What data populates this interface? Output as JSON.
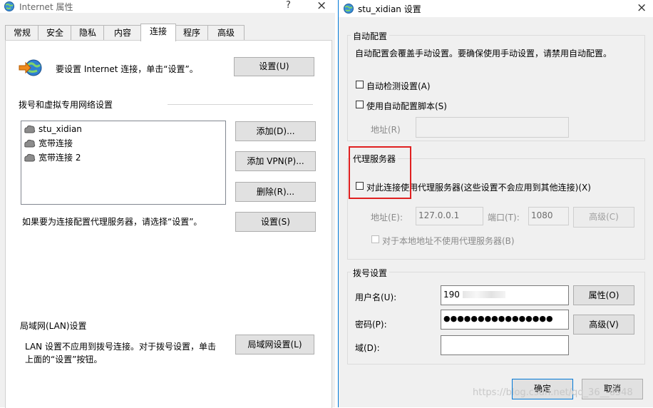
{
  "left_window": {
    "title": "Internet 属性",
    "help_glyph": "?",
    "close_glyph": "×",
    "tabs": [
      "常规",
      "安全",
      "隐私",
      "内容",
      "连接",
      "程序",
      "高级"
    ],
    "active_tab": "连接",
    "setup_text": "要设置 Internet 连接，单击“设置”。",
    "setup_button": "设置(U)",
    "dialup_section": "拨号和虚拟专用网络设置",
    "connections": [
      "stu_xidian",
      "宽带连接",
      "宽带连接 2"
    ],
    "add_button": "添加(D)...",
    "add_vpn_button": "添加 VPN(P)...",
    "delete_button": "删除(R)...",
    "proxy_hint": "如果要为连接配置代理服务器，请选择“设置”。",
    "settings_button": "设置(S)",
    "lan_section": "局域网(LAN)设置",
    "lan_text_line1": "LAN 设置不应用到拨号连接。对于拨号设置，单击",
    "lan_text_line2": "上面的“设置”按钮。",
    "lan_button": "局域网设置(L)"
  },
  "right_window": {
    "title": "stu_xidian 设置",
    "close_glyph": "×",
    "auto_config": {
      "group_title": "自动配置",
      "description": "自动配置会覆盖手动设置。要确保使用手动设置，请禁用自动配置。",
      "auto_detect_label": "自动检测设置(A)",
      "auto_detect_checked": false,
      "use_script_label": "使用自动配置脚本(S)",
      "use_script_checked": false,
      "address_label": "地址(R)",
      "address_value": ""
    },
    "proxy": {
      "group_title": "代理服务器",
      "use_proxy_label": "对此连接使用代理服务器(这些设置不会应用到其他连接)(X)",
      "use_proxy_checked": false,
      "address_label": "地址(E):",
      "address_value": "127.0.0.1",
      "port_label": "端口(T):",
      "port_value": "1080",
      "advanced_button": "高级(C)",
      "bypass_local_label": "对于本地地址不使用代理服务器(B)",
      "bypass_local_checked": false
    },
    "dialup": {
      "group_title": "拨号设置",
      "username_label": "用户名(U):",
      "username_value": "190",
      "password_label": "密码(P):",
      "password_value": "●●●●●●●●●●●●●●●●",
      "domain_label": "域(D):",
      "domain_value": "",
      "properties_button": "属性(O)",
      "advanced_button": "高级(V)"
    },
    "ok_button": "确定",
    "cancel_button": "取消"
  },
  "watermark": "https://blog.csdn.net/qq_36__6548",
  "colors": {
    "accent": "#0078d7",
    "highlight_box": "#e02020",
    "dialog_bg": "#f0f0f0"
  }
}
